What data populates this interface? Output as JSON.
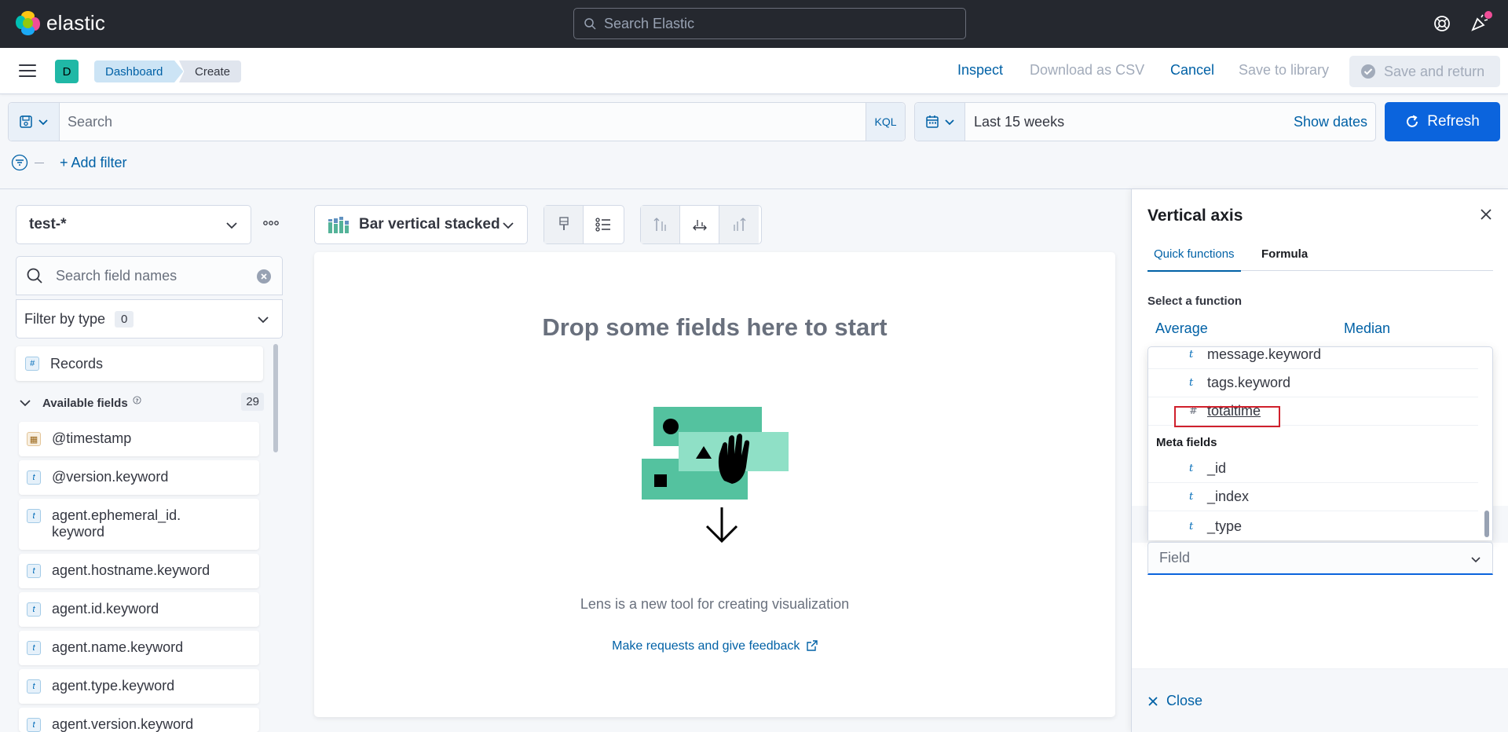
{
  "header": {
    "app_name": "elastic",
    "search_placeholder": "Search Elastic",
    "space_initial": "D",
    "breadcrumbs": [
      "Dashboard",
      "Create"
    ],
    "actions": {
      "inspect": "Inspect",
      "download_csv": "Download as CSV",
      "cancel": "Cancel",
      "save_library": "Save to library",
      "save_return": "Save and return"
    }
  },
  "query": {
    "placeholder": "Search",
    "language": "KQL",
    "date_range": "Last 15 weeks",
    "show_dates": "Show dates",
    "refresh": "Refresh",
    "add_filter": "+ Add filter"
  },
  "sidebar": {
    "index_pattern": "test-*",
    "search_placeholder": "Search field names",
    "filter_by_type": "Filter by type",
    "filter_count": "0",
    "records": "Records",
    "available_label": "Available fields",
    "available_count": "29",
    "fields": [
      {
        "type": "date",
        "token": "▦",
        "name": "@timestamp"
      },
      {
        "type": "string",
        "token": "t",
        "name": "@version.keyword"
      },
      {
        "type": "string",
        "token": "t",
        "name": "agent.ephemeral_id.\nkeyword"
      },
      {
        "type": "string",
        "token": "t",
        "name": "agent.hostname.keyword"
      },
      {
        "type": "string",
        "token": "t",
        "name": "agent.id.keyword"
      },
      {
        "type": "string",
        "token": "t",
        "name": "agent.name.keyword"
      },
      {
        "type": "string",
        "token": "t",
        "name": "agent.type.keyword"
      },
      {
        "type": "string",
        "token": "t",
        "name": "agent.version.keyword"
      }
    ]
  },
  "workspace": {
    "chart_type": "Bar vertical stacked",
    "empty_title": "Drop some fields here to start",
    "empty_sub": "Lens is a new tool for creating visualization",
    "feedback": "Make requests and give feedback"
  },
  "flyout": {
    "title": "Vertical axis",
    "tabs": [
      "Quick functions",
      "Formula"
    ],
    "select_label": "Select a function",
    "functions": [
      "Average",
      "Median"
    ],
    "dropdown_fields": [
      {
        "token": "t",
        "name": "message.keyword"
      },
      {
        "token": "t",
        "name": "tags.keyword"
      },
      {
        "token": "#",
        "name": "totaltime"
      }
    ],
    "meta_label": "Meta fields",
    "meta_fields": [
      {
        "token": "t",
        "name": "_id"
      },
      {
        "token": "t",
        "name": "_index"
      },
      {
        "token": "t",
        "name": "_type"
      }
    ],
    "field_placeholder": "Field",
    "close": "Close"
  },
  "colors": {
    "header_bg": "#25282f",
    "link": "#0061a6",
    "primary": "#0b64dd",
    "illustration": "#54c29f"
  }
}
